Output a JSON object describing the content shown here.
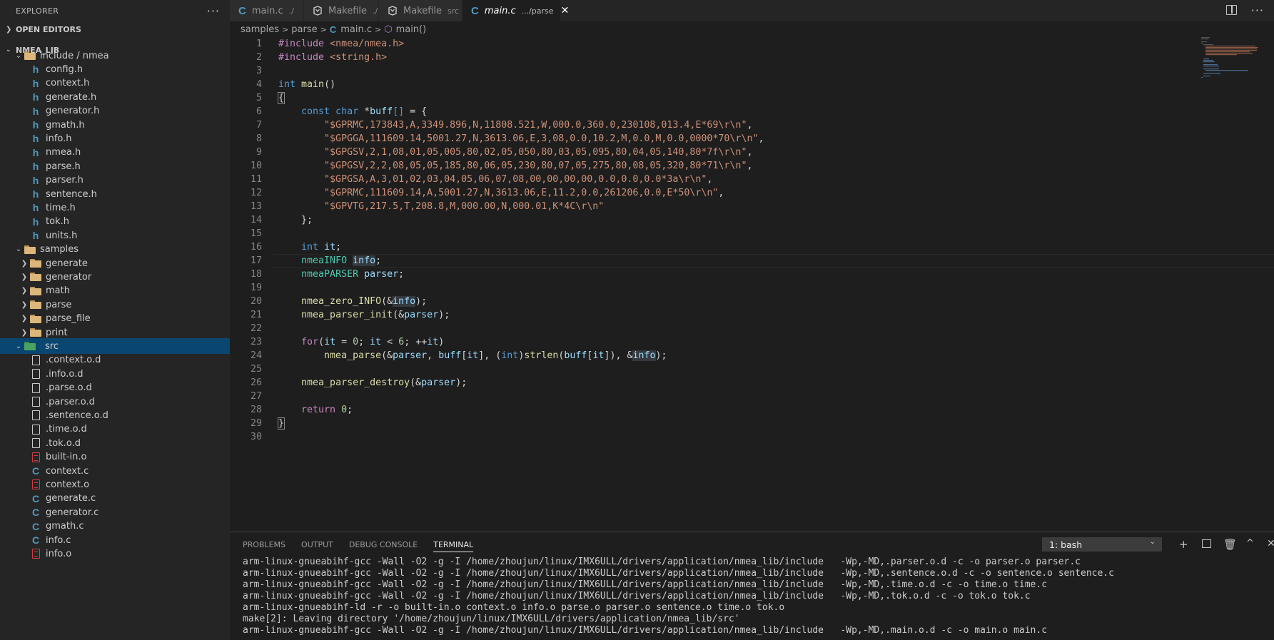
{
  "explorer": {
    "title": "EXPLORER",
    "more": "···",
    "open_editors": "OPEN EDITORS",
    "project": "NMEA_LIB",
    "tree": [
      {
        "label": "include / nmea",
        "kind": "folder",
        "depth": 1,
        "open": true
      },
      {
        "label": "config.h",
        "kind": "h",
        "depth": 2
      },
      {
        "label": "context.h",
        "kind": "h",
        "depth": 2
      },
      {
        "label": "generate.h",
        "kind": "h",
        "depth": 2
      },
      {
        "label": "generator.h",
        "kind": "h",
        "depth": 2
      },
      {
        "label": "gmath.h",
        "kind": "h",
        "depth": 2
      },
      {
        "label": "info.h",
        "kind": "h",
        "depth": 2
      },
      {
        "label": "nmea.h",
        "kind": "h",
        "depth": 2
      },
      {
        "label": "parse.h",
        "kind": "h",
        "depth": 2
      },
      {
        "label": "parser.h",
        "kind": "h",
        "depth": 2
      },
      {
        "label": "sentence.h",
        "kind": "h",
        "depth": 2
      },
      {
        "label": "time.h",
        "kind": "h",
        "depth": 2
      },
      {
        "label": "tok.h",
        "kind": "h",
        "depth": 2
      },
      {
        "label": "units.h",
        "kind": "h",
        "depth": 2
      },
      {
        "label": "samples",
        "kind": "folder",
        "depth": 1,
        "open": true
      },
      {
        "label": "generate",
        "kind": "folder",
        "depth": 2,
        "open": false
      },
      {
        "label": "generator",
        "kind": "folder",
        "depth": 2,
        "open": false
      },
      {
        "label": "math",
        "kind": "folder",
        "depth": 2,
        "open": false
      },
      {
        "label": "parse",
        "kind": "folder",
        "depth": 2,
        "open": false
      },
      {
        "label": "parse_file",
        "kind": "folder",
        "depth": 2,
        "open": false
      },
      {
        "label": "print",
        "kind": "folder",
        "depth": 2,
        "open": false
      },
      {
        "label": "src",
        "kind": "srcfolder",
        "depth": 1,
        "open": true,
        "selected": true
      },
      {
        "label": ".context.o.d",
        "kind": "d",
        "depth": 2
      },
      {
        "label": ".info.o.d",
        "kind": "d",
        "depth": 2
      },
      {
        "label": ".parse.o.d",
        "kind": "d",
        "depth": 2
      },
      {
        "label": ".parser.o.d",
        "kind": "d",
        "depth": 2
      },
      {
        "label": ".sentence.o.d",
        "kind": "d",
        "depth": 2
      },
      {
        "label": ".time.o.d",
        "kind": "d",
        "depth": 2
      },
      {
        "label": ".tok.o.d",
        "kind": "d",
        "depth": 2
      },
      {
        "label": "built-in.o",
        "kind": "o",
        "depth": 2
      },
      {
        "label": "context.c",
        "kind": "c",
        "depth": 2
      },
      {
        "label": "context.o",
        "kind": "o",
        "depth": 2
      },
      {
        "label": "generate.c",
        "kind": "c",
        "depth": 2
      },
      {
        "label": "generator.c",
        "kind": "c",
        "depth": 2
      },
      {
        "label": "gmath.c",
        "kind": "c",
        "depth": 2
      },
      {
        "label": "info.c",
        "kind": "c",
        "depth": 2
      },
      {
        "label": "info.o",
        "kind": "o",
        "depth": 2
      }
    ]
  },
  "tabs": [
    {
      "icon": "c",
      "label": "main.c",
      "desc": "./",
      "active": false
    },
    {
      "icon": "makefile",
      "label": "Makefile",
      "desc": "./",
      "active": false
    },
    {
      "icon": "makefile",
      "label": "Makefile",
      "desc": "src",
      "active": false
    },
    {
      "icon": "c",
      "label": "main.c",
      "desc": ".../parse",
      "active": true
    }
  ],
  "breadcrumb": {
    "a": "samples",
    "b": "parse",
    "c": "main.c",
    "d": "main()"
  },
  "code": [
    [
      [
        "ctl",
        "#include "
      ],
      [
        "str",
        "<nmea/nmea.h>"
      ]
    ],
    [
      [
        "ctl",
        "#include "
      ],
      [
        "str",
        "<string.h>"
      ]
    ],
    [],
    [
      [
        "kw",
        "int "
      ],
      [
        "fn",
        "main"
      ],
      [
        "p",
        "()"
      ]
    ],
    [
      [
        "brk",
        "{"
      ]
    ],
    [
      [
        "p",
        "    "
      ],
      [
        "kw",
        "const char "
      ],
      [
        "p",
        "*"
      ],
      [
        "var",
        "buff"
      ],
      [
        "kw",
        "[]"
      ],
      [
        "p",
        " = {"
      ]
    ],
    [
      [
        "p",
        "        "
      ],
      [
        "str",
        "\"$GPRMC,173843,A,3349.896,N,11808.521,W,000.0,360.0,230108,013.4,E*69\\r\\n\""
      ],
      [
        "p",
        ","
      ]
    ],
    [
      [
        "p",
        "        "
      ],
      [
        "str",
        "\"$GPGGA,111609.14,5001.27,N,3613.06,E,3,08,0.0,10.2,M,0.0,M,0.0,0000*70\\r\\n\""
      ],
      [
        "p",
        ","
      ]
    ],
    [
      [
        "p",
        "        "
      ],
      [
        "str",
        "\"$GPGSV,2,1,08,01,05,005,80,02,05,050,80,03,05,095,80,04,05,140,80*7f\\r\\n\""
      ],
      [
        "p",
        ","
      ]
    ],
    [
      [
        "p",
        "        "
      ],
      [
        "str",
        "\"$GPGSV,2,2,08,05,05,185,80,06,05,230,80,07,05,275,80,08,05,320,80*71\\r\\n\""
      ],
      [
        "p",
        ","
      ]
    ],
    [
      [
        "p",
        "        "
      ],
      [
        "str",
        "\"$GPGSA,A,3,01,02,03,04,05,06,07,08,00,00,00,00,0.0,0.0,0.0*3a\\r\\n\""
      ],
      [
        "p",
        ","
      ]
    ],
    [
      [
        "p",
        "        "
      ],
      [
        "str",
        "\"$GPRMC,111609.14,A,5001.27,N,3613.06,E,11.2,0.0,261206,0.0,E*50\\r\\n\""
      ],
      [
        "p",
        ","
      ]
    ],
    [
      [
        "p",
        "        "
      ],
      [
        "str",
        "\"$GPVTG,217.5,T,208.8,M,000.00,N,000.01,K*4C\\r\\n\""
      ]
    ],
    [
      [
        "p",
        "    };"
      ]
    ],
    [],
    [
      [
        "p",
        "    "
      ],
      [
        "kw",
        "int "
      ],
      [
        "var",
        "it"
      ],
      [
        "p",
        ";"
      ]
    ],
    [
      [
        "p",
        "    "
      ],
      [
        "ty",
        "nmeaINFO "
      ],
      [
        "hlvar",
        "info"
      ],
      [
        "p",
        ";"
      ]
    ],
    [
      [
        "p",
        "    "
      ],
      [
        "ty",
        "nmeaPARSER "
      ],
      [
        "var",
        "parser"
      ],
      [
        "p",
        ";"
      ]
    ],
    [],
    [
      [
        "p",
        "    "
      ],
      [
        "fn",
        "nmea_zero_INFO"
      ],
      [
        "p",
        "(&"
      ],
      [
        "hlvar",
        "info"
      ],
      [
        "p",
        ");"
      ]
    ],
    [
      [
        "p",
        "    "
      ],
      [
        "fn",
        "nmea_parser_init"
      ],
      [
        "p",
        "(&"
      ],
      [
        "var",
        "parser"
      ],
      [
        "p",
        ");"
      ]
    ],
    [],
    [
      [
        "p",
        "    "
      ],
      [
        "ctl",
        "for"
      ],
      [
        "p",
        "("
      ],
      [
        "var",
        "it"
      ],
      [
        "p",
        " = "
      ],
      [
        "num",
        "0"
      ],
      [
        "p",
        "; "
      ],
      [
        "var",
        "it"
      ],
      [
        "p",
        " < "
      ],
      [
        "num",
        "6"
      ],
      [
        "p",
        "; ++"
      ],
      [
        "var",
        "it"
      ],
      [
        "p",
        ")"
      ]
    ],
    [
      [
        "p",
        "        "
      ],
      [
        "fn",
        "nmea_parse"
      ],
      [
        "p",
        "(&"
      ],
      [
        "var",
        "parser"
      ],
      [
        "p",
        ", "
      ],
      [
        "var",
        "buff"
      ],
      [
        "p",
        "["
      ],
      [
        "var",
        "it"
      ],
      [
        "p",
        "], ("
      ],
      [
        "kw",
        "int"
      ],
      [
        "p",
        ")"
      ],
      [
        "fn",
        "strlen"
      ],
      [
        "p",
        "("
      ],
      [
        "var",
        "buff"
      ],
      [
        "p",
        "["
      ],
      [
        "var",
        "it"
      ],
      [
        "p",
        "]), &"
      ],
      [
        "hlvar",
        "info"
      ],
      [
        "p",
        ");"
      ]
    ],
    [],
    [
      [
        "p",
        "    "
      ],
      [
        "fn",
        "nmea_parser_destroy"
      ],
      [
        "p",
        "(&"
      ],
      [
        "var",
        "parser"
      ],
      [
        "p",
        ");"
      ]
    ],
    [],
    [
      [
        "p",
        "    "
      ],
      [
        "ctl",
        "return "
      ],
      [
        "num",
        "0"
      ],
      [
        "p",
        ";"
      ]
    ],
    [
      [
        "brk",
        "}"
      ]
    ],
    []
  ],
  "current_line": 17,
  "panel": {
    "tabs": [
      "PROBLEMS",
      "OUTPUT",
      "DEBUG CONSOLE",
      "TERMINAL"
    ],
    "active_tab": "TERMINAL",
    "terminal_select": "1: bash",
    "terminal_lines": [
      "arm-linux-gnueabihf-gcc -Wall -O2 -g -I /home/zhoujun/linux/IMX6ULL/drivers/application/nmea_lib/include   -Wp,-MD,.parser.o.d -c -o parser.o parser.c",
      "arm-linux-gnueabihf-gcc -Wall -O2 -g -I /home/zhoujun/linux/IMX6ULL/drivers/application/nmea_lib/include   -Wp,-MD,.sentence.o.d -c -o sentence.o sentence.c",
      "arm-linux-gnueabihf-gcc -Wall -O2 -g -I /home/zhoujun/linux/IMX6ULL/drivers/application/nmea_lib/include   -Wp,-MD,.time.o.d -c -o time.o time.c",
      "arm-linux-gnueabihf-gcc -Wall -O2 -g -I /home/zhoujun/linux/IMX6ULL/drivers/application/nmea_lib/include   -Wp,-MD,.tok.o.d -c -o tok.o tok.c",
      "arm-linux-gnueabihf-ld -r -o built-in.o context.o info.o parse.o parser.o sentence.o time.o tok.o",
      "make[2]: Leaving directory '/home/zhoujun/linux/IMX6ULL/drivers/application/nmea_lib/src'",
      "arm-linux-gnueabihf-gcc -Wall -O2 -g -I /home/zhoujun/linux/IMX6ULL/drivers/application/nmea_lib/include   -Wp,-MD,.main.o.d -c -o main.o main.c"
    ]
  },
  "colors": {
    "selection": "#094771",
    "c_icon": "#519aba",
    "folder": "#dcb67a",
    "src_folder": "#4aa35f"
  }
}
